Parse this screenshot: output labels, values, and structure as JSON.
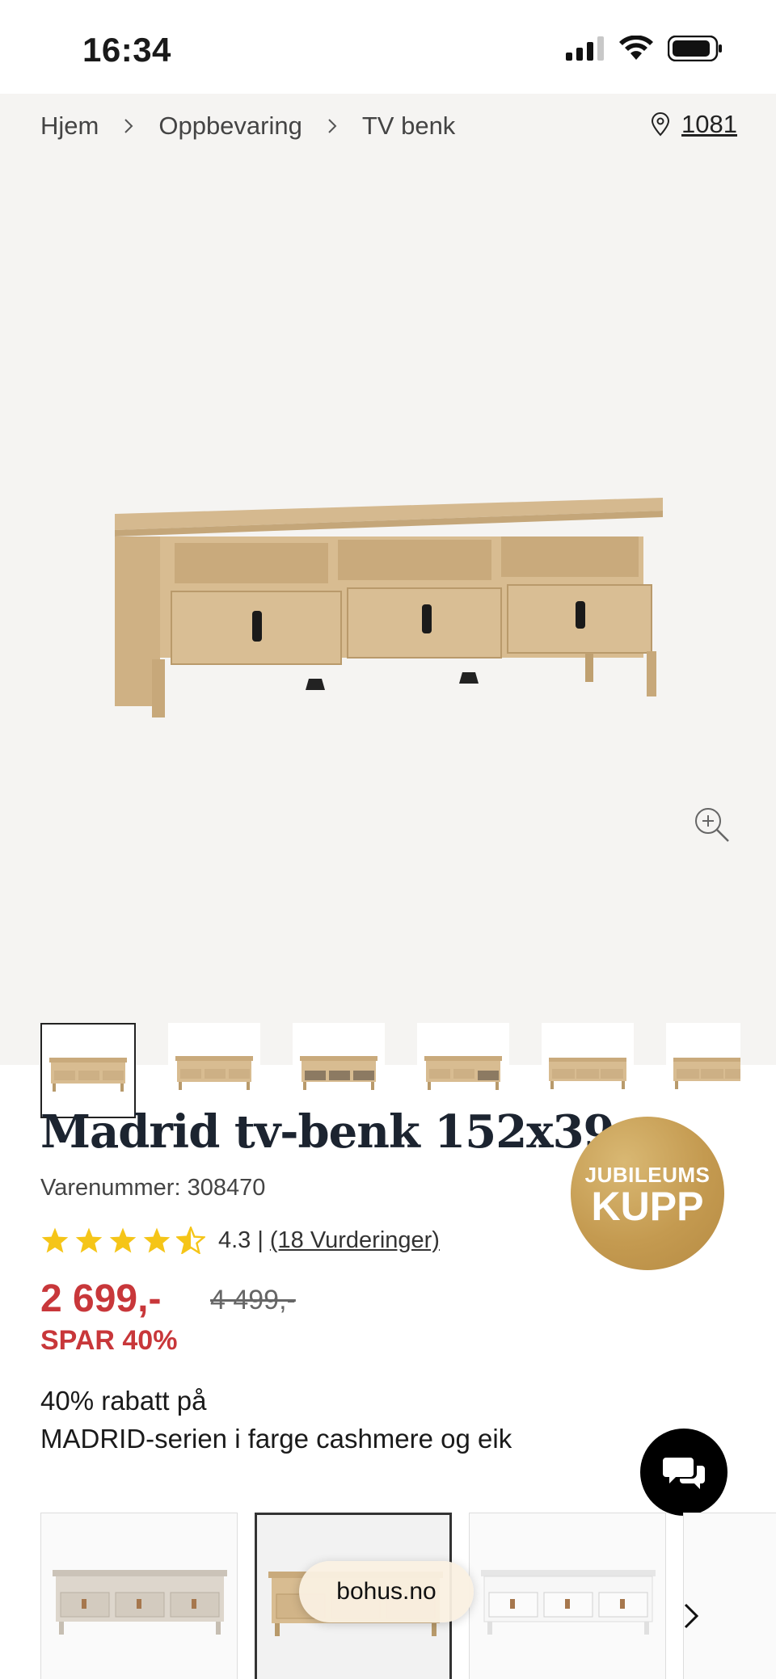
{
  "status_bar": {
    "time": "16:34"
  },
  "breadcrumb": {
    "items": [
      "Hjem",
      "Oppbevaring",
      "TV benk"
    ]
  },
  "location": {
    "code": "1081"
  },
  "thumbnails": {
    "count": 6,
    "active_index": 0
  },
  "product": {
    "title": "Madrid tv-benk 152x39",
    "sku": "Varenummer: 308470",
    "rating": {
      "value": "4.3",
      "stars": 4.5,
      "reviews": "(18 Vurderinger)"
    },
    "price": "2 699,-",
    "old_price": "4 499,-",
    "save": "SPAR 40%",
    "promo_line1": "40% rabatt på",
    "promo_line2": "MADRID-serien i farge cashmere og eik"
  },
  "badge": {
    "line1": "JUBILEUMS",
    "line2": "KUPP"
  },
  "browser": {
    "url": "bohus.no"
  },
  "colors": {
    "price_red": "#c8373a",
    "badge_gold": "#c49a50",
    "star_yellow": "#f5c518",
    "gallery_bg": "#f5f4f2"
  },
  "icons": [
    "location-pin-icon",
    "chevron-right-icon",
    "zoom-in-icon",
    "star-icon",
    "chat-icon"
  ]
}
